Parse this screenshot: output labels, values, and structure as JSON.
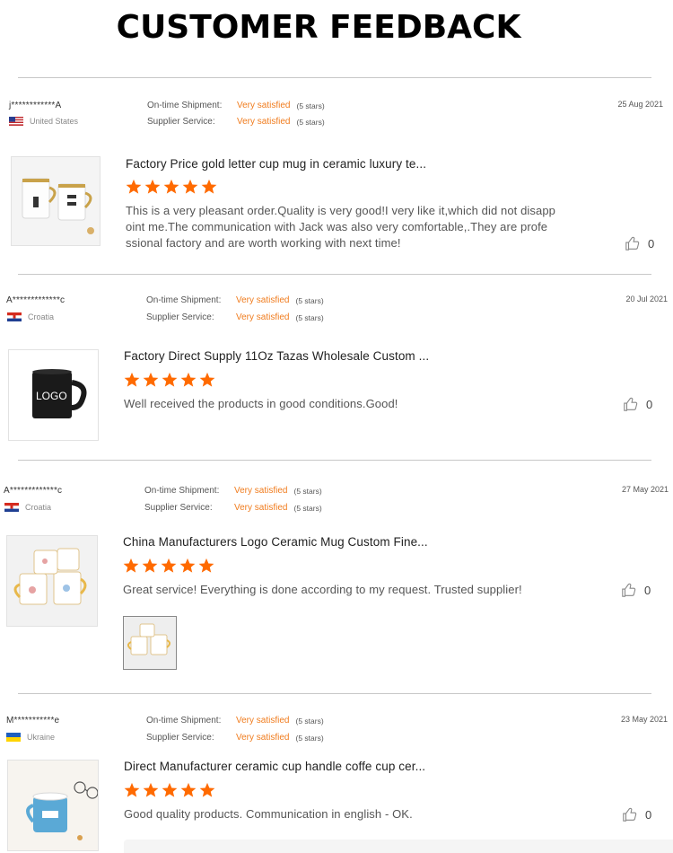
{
  "page": {
    "title": "CUSTOMER FEEDBACK"
  },
  "colors": {
    "accent_orange": "#f07c1e",
    "star": "#ff6a00",
    "divider": "#c8c8c8"
  },
  "reviews": [
    {
      "buyer": "j************A",
      "country": "United States",
      "flag": "us-flag",
      "date": "25 Aug 2021",
      "shipment_label": "On-time Shipment:",
      "shipment_value": "Very satisfied",
      "shipment_stars": "(5 stars)",
      "supplier_label": "Supplier Service:",
      "supplier_value": "Very satisfied",
      "supplier_stars": "(5 stars)",
      "product_title": "Factory Price gold letter cup mug in ceramic luxury te...",
      "rating": 5,
      "text": "This is a very pleasant order.Quality is very good!I very like it,which did not disapp oint me.The communication with Jack was also very comfortable,.They are profe ssional factory and are worth working with next time!",
      "likes": "0"
    },
    {
      "buyer": "A*************c",
      "country": "Croatia",
      "flag": "croatia-flag",
      "date": "20 Jul 2021",
      "shipment_label": "On-time Shipment:",
      "shipment_value": "Very satisfied",
      "shipment_stars": "(5 stars)",
      "supplier_label": "Supplier Service:",
      "supplier_value": "Very satisfied",
      "supplier_stars": "(5 stars)",
      "product_title": "Factory Direct Supply 11Oz Tazas Wholesale Custom ...",
      "product_image_text": "LOGO",
      "rating": 5,
      "text": "Well received the products in good conditions.Good!",
      "likes": "0"
    },
    {
      "buyer": "A*************c",
      "country": "Croatia",
      "flag": "croatia-flag",
      "date": "27 May 2021",
      "shipment_label": "On-time Shipment:",
      "shipment_value": "Very satisfied",
      "shipment_stars": "(5 stars)",
      "supplier_label": "Supplier Service:",
      "supplier_value": "Very satisfied",
      "supplier_stars": "(5 stars)",
      "product_title": "China Manufacturers Logo Ceramic Mug Custom Fine...",
      "rating": 5,
      "text": "Great service! Everything is done according to my request. Trusted supplier!",
      "likes": "0"
    },
    {
      "buyer": "M***********e",
      "country": "Ukraine",
      "flag": "ukraine-flag",
      "date": "23 May 2021",
      "shipment_label": "On-time Shipment:",
      "shipment_value": "Very satisfied",
      "shipment_stars": "(5 stars)",
      "supplier_label": "Supplier Service:",
      "supplier_value": "Very satisfied",
      "supplier_stars": "(5 stars)",
      "product_title": "Direct Manufacturer ceramic cup handle coffe cup cer...",
      "rating": 5,
      "text": "Good quality products. Communication in english - OK.",
      "likes": "0"
    }
  ]
}
